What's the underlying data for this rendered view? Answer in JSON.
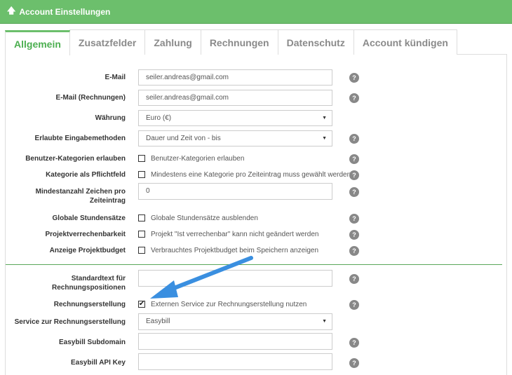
{
  "header": {
    "title": "Account Einstellungen"
  },
  "tabs": [
    {
      "label": "Allgemein",
      "active": true
    },
    {
      "label": "Zusatzfelder"
    },
    {
      "label": "Zahlung"
    },
    {
      "label": "Rechnungen"
    },
    {
      "label": "Datenschutz"
    },
    {
      "label": "Account kündigen"
    }
  ],
  "form": {
    "email": {
      "label": "E-Mail",
      "value": "seiler.andreas@gmail.com"
    },
    "email_invoice": {
      "label": "E-Mail (Rechnungen)",
      "value": "seiler.andreas@gmail.com"
    },
    "currency": {
      "label": "Währung",
      "value": "Euro (€)"
    },
    "input_methods": {
      "label": "Erlaubte Eingabemethoden",
      "value": "Dauer und Zeit von - bis"
    },
    "user_categories": {
      "label": "Benutzer-Kategorien erlauben",
      "text": "Benutzer-Kategorien erlauben",
      "checked": false
    },
    "category_required": {
      "label": "Kategorie als Pflichtfeld",
      "text": "Mindestens eine Kategorie pro Zeiteintrag muss gewählt werden",
      "checked": false
    },
    "min_chars": {
      "label_line1": "Mindestanzahl Zeichen pro",
      "label_line2": "Zeiteintrag",
      "value": "0"
    },
    "global_rates": {
      "label": "Globale Stundensätze",
      "text": "Globale Stundensätze ausblenden",
      "checked": false
    },
    "billability": {
      "label": "Projektverrechenbarkeit",
      "text": "Projekt \"Ist verrechenbar\" kann nicht geändert werden",
      "checked": false
    },
    "project_budget": {
      "label": "Anzeige Projektbudget",
      "text": "Verbrauchtes Projektbudget beim Speichern anzeigen",
      "checked": false
    },
    "default_text": {
      "label_line1": "Standardtext für",
      "label_line2": "Rechnungspositionen",
      "value": ""
    },
    "invoice_creation": {
      "label": "Rechnungserstellung",
      "text": "Externen Service zur Rechnungserstellung nutzen",
      "checked": true,
      "check_glyph": "✔"
    },
    "invoice_service": {
      "label": "Service zur Rechnungserstellung",
      "value": "Easybill"
    },
    "easybill_subdomain": {
      "label": "Easybill Subdomain",
      "value": ""
    },
    "easybill_api_key": {
      "label": "Easybill API Key",
      "value": ""
    }
  },
  "help_glyph": "?",
  "colors": {
    "accent": "#6cbf6c",
    "arrow": "#3a8fe0"
  }
}
